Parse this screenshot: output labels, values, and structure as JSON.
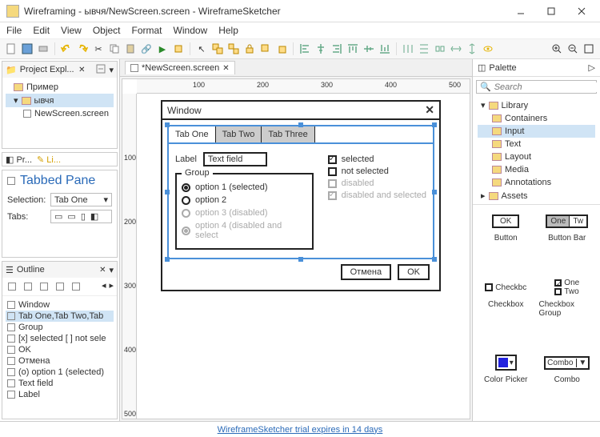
{
  "window": {
    "title": "Wireframing - ывчя/NewScreen.screen - WireframeSketcher"
  },
  "menu": [
    "File",
    "Edit",
    "View",
    "Object",
    "Format",
    "Window",
    "Help"
  ],
  "projectExplorer": {
    "title": "Project Expl...",
    "items": [
      {
        "label": "Пример",
        "indent": 0
      },
      {
        "label": "ывчя",
        "indent": 0,
        "sel": true
      },
      {
        "label": "NewScreen.screen",
        "indent": 1
      }
    ]
  },
  "miniTabs": {
    "a": "Pr...",
    "b": "Li..."
  },
  "tabbedPane": {
    "title": "Tabbed Pane",
    "selectionLabel": "Selection:",
    "selectionValue": "Tab One",
    "tabsLabel": "Tabs:"
  },
  "outline": {
    "title": "Outline",
    "items": [
      "Window",
      "Tab One,Tab Two,Tab",
      "Group",
      "[x] selected [ ] not sele",
      "OK",
      "Отмена",
      "(o) option 1 (selected)",
      "Text field",
      "Label"
    ],
    "selIndex": 1
  },
  "editor": {
    "tab": "*NewScreen.screen",
    "hruler": [
      "100",
      "200",
      "300",
      "400",
      "500"
    ],
    "vruler": [
      "100",
      "200",
      "300",
      "400",
      "500"
    ]
  },
  "wf": {
    "windowTitle": "Window",
    "tabs": [
      "Tab One",
      "Tab Two",
      "Tab Three"
    ],
    "label": "Label",
    "textfield": "Text field",
    "group": "Group",
    "radios": [
      {
        "t": "option 1 (selected)",
        "on": true,
        "dis": false
      },
      {
        "t": "option 2",
        "on": false,
        "dis": false
      },
      {
        "t": "option 3 (disabled)",
        "on": false,
        "dis": true
      },
      {
        "t": "option 4 (disabled and select",
        "on": true,
        "dis": true
      }
    ],
    "checks": [
      {
        "t": "selected",
        "on": true,
        "dis": false
      },
      {
        "t": "not selected",
        "on": false,
        "dis": false
      },
      {
        "t": "disabled",
        "on": false,
        "dis": true
      },
      {
        "t": "disabled and selected",
        "on": true,
        "dis": true
      }
    ],
    "btnCancel": "Отмена",
    "btnOk": "OK"
  },
  "palette": {
    "title": "Palette",
    "searchPh": "Search",
    "tree": {
      "library": "Library",
      "cats": [
        "Containers",
        "Input",
        "Text",
        "Layout",
        "Media",
        "Annotations"
      ],
      "selCat": "Input",
      "assets": "Assets"
    },
    "grid": [
      {
        "preview": "OK",
        "label": "Button",
        "kind": "btn"
      },
      {
        "preview": "One | Tw",
        "label": "Button Bar",
        "kind": "btnbar"
      },
      {
        "preview": "Checkbc",
        "label": "Checkbox",
        "kind": "cb"
      },
      {
        "preview": "One / Two",
        "label": "Checkbox Group",
        "kind": "cbg"
      },
      {
        "preview": "",
        "label": "Color Picker",
        "kind": "color"
      },
      {
        "preview": "Combo",
        "label": "Combo",
        "kind": "combo"
      }
    ]
  },
  "status": "WireframeSketcher trial expires in 14 days"
}
